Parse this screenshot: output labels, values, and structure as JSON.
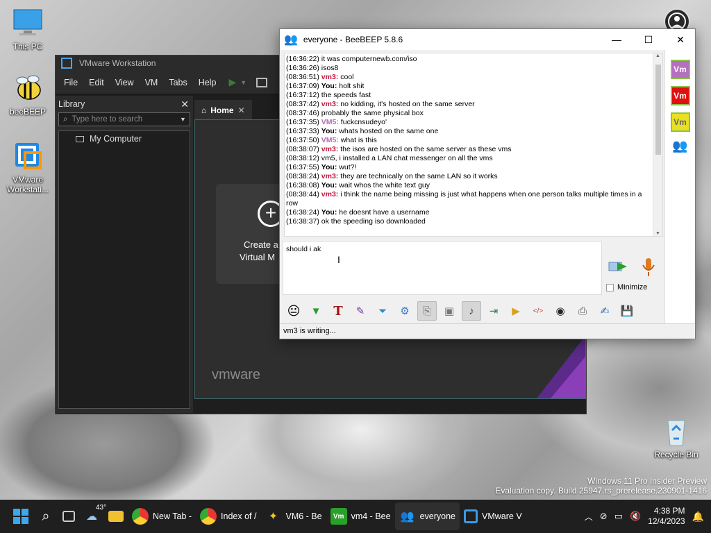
{
  "desktop": {
    "icons": [
      {
        "label": "This PC"
      },
      {
        "label": "beeBEEP"
      },
      {
        "label": "VMware Workstati..."
      },
      {
        "label": "Recycle Bin"
      }
    ]
  },
  "vmware": {
    "title": "VMware Workstation",
    "menu": [
      "File",
      "Edit",
      "View",
      "VM",
      "Tabs",
      "Help"
    ],
    "library": {
      "title": "Library",
      "search_placeholder": "Type here to search",
      "tree_item": "My Computer"
    },
    "tab_home": "Home",
    "create_label": "Create a",
    "create_label2": "Virtual M",
    "logo": "vmware"
  },
  "beebeep": {
    "title": "everyone - BeeBEEP 5.8.6",
    "chat": [
      {
        "time": "(16:36:22)",
        "who": "",
        "text": " it was   computernewb.com/iso"
      },
      {
        "time": "(16:36:26)",
        "who": "",
        "text": " isos8"
      },
      {
        "time": "(08:36:51)",
        "who": "vm3",
        "text": " cool"
      },
      {
        "time": "(16:37:09)",
        "who": "You",
        "text": " holt shit"
      },
      {
        "time": "(16:37:12)",
        "who": "",
        "text": " the speeds fast"
      },
      {
        "time": "(08:37:42)",
        "who": "vm3",
        "text": " no kidding, it's hosted on the same server"
      },
      {
        "time": "(08:37:46)",
        "who": "",
        "text": " probably the same physical box"
      },
      {
        "time": "(16:37:35)",
        "who": "VM5",
        "text": " fuckcnsudeyo'"
      },
      {
        "time": "(16:37:33)",
        "who": "You",
        "text": " whats hosted on the same one"
      },
      {
        "time": "(16:37:50)",
        "who": "VM5",
        "text": " what is this"
      },
      {
        "time": "(08:38:07)",
        "who": "vm3",
        "text": " the isos are hosted on the same server as these vms"
      },
      {
        "time": "(08:38:12)",
        "who": "",
        "text": " vm5, i installed a LAN chat messenger on all the vms"
      },
      {
        "time": "(16:37:55)",
        "who": "You",
        "text": " wut?!"
      },
      {
        "time": "(08:38:24)",
        "who": "vm3",
        "text": " they are technically on the same LAN so it works"
      },
      {
        "time": "(16:38:08)",
        "who": "You",
        "text": " wait whos the white text guy"
      },
      {
        "time": "(08:38:44)",
        "who": "vm3",
        "text": " i think the name being missing is just what happens when one person talks multiple times in a row"
      },
      {
        "time": "(16:38:24)",
        "who": "You",
        "text": " he doesnt have a username"
      },
      {
        "time": "(16:38:37)",
        "who": "",
        "text": " ok the speeding iso downloaded"
      }
    ],
    "input_value": "should i ak",
    "minimize_label": "Minimize",
    "status": "vm3 is writing...",
    "side_users": [
      "Vm",
      "Vm",
      "Vm"
    ]
  },
  "watermark": {
    "line1": "Windows 11 Pro Insider Preview",
    "line2": "Evaluation copy. Build 25947.rs_prerelease.230901-1416"
  },
  "taskbar": {
    "weather_temp": "43°",
    "items": [
      {
        "label": "New Tab -"
      },
      {
        "label": "Index of /"
      },
      {
        "label": "VM6 - Be"
      },
      {
        "label": "vm4 - Bee"
      },
      {
        "label": "everyone"
      },
      {
        "label": "VMware V"
      }
    ],
    "time": "4:38 PM",
    "date": "12/4/2023"
  },
  "colors": {
    "vm3": "#c0143c",
    "vm5": "#b36bb0",
    "you": "#000000",
    "vm_badge_purple": "#b56fc0",
    "vm_badge_red": "#e01010",
    "vm_badge_yellow": "#e8e020"
  }
}
